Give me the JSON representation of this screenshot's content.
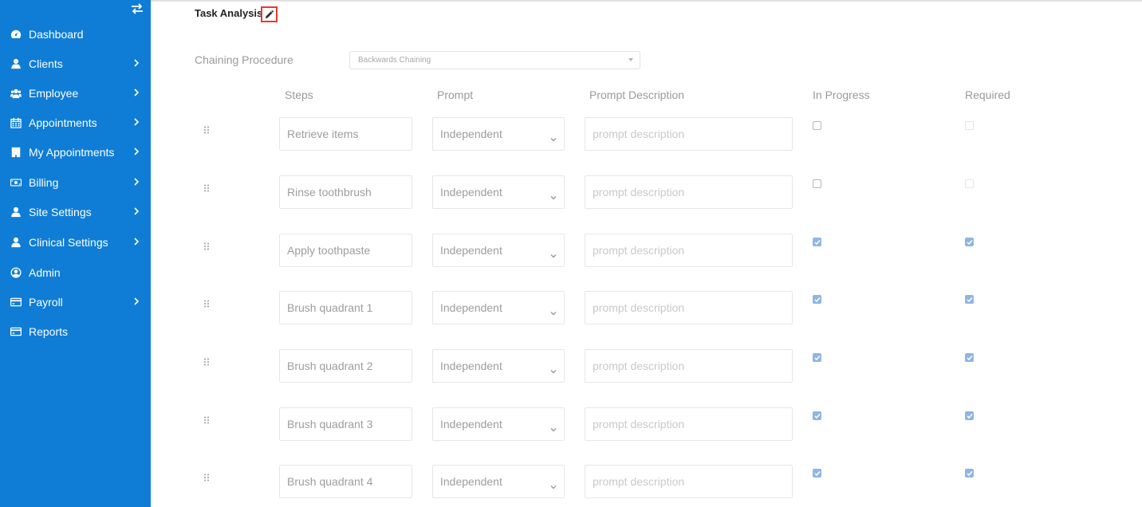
{
  "sidebar": {
    "items": [
      {
        "label": "Dashboard",
        "icon": "dashboard-icon",
        "has_submenu": false
      },
      {
        "label": "Clients",
        "icon": "user-icon",
        "has_submenu": true
      },
      {
        "label": "Employee",
        "icon": "users-icon",
        "has_submenu": true
      },
      {
        "label": "Appointments",
        "icon": "calendar-icon",
        "has_submenu": true
      },
      {
        "label": "My Appointments",
        "icon": "building-icon",
        "has_submenu": true
      },
      {
        "label": "Billing",
        "icon": "money-icon",
        "has_submenu": true
      },
      {
        "label": "Site Settings",
        "icon": "user-icon",
        "has_submenu": true
      },
      {
        "label": "Clinical Settings",
        "icon": "user-icon",
        "has_submenu": true
      },
      {
        "label": "Admin",
        "icon": "user-circle-icon",
        "has_submenu": false
      },
      {
        "label": "Payroll",
        "icon": "credit-card-icon",
        "has_submenu": true
      },
      {
        "label": "Reports",
        "icon": "credit-card-icon",
        "has_submenu": false
      }
    ]
  },
  "header": {
    "title": "Task Analysis"
  },
  "chaining": {
    "label": "Chaining Procedure",
    "value": "Backwards Chaining"
  },
  "columns": {
    "steps": "Steps",
    "prompt": "Prompt",
    "description": "Prompt Description",
    "in_progress": "In Progress",
    "required": "Required"
  },
  "rows": [
    {
      "step": "Retrieve items",
      "prompt": "Independent",
      "description_placeholder": "prompt description",
      "in_progress": false,
      "required": false
    },
    {
      "step": "Rinse toothbrush",
      "prompt": "Independent",
      "description_placeholder": "prompt description",
      "in_progress": false,
      "required": false
    },
    {
      "step": "Apply toothpaste",
      "prompt": "Independent",
      "description_placeholder": "prompt description",
      "in_progress": true,
      "required": true
    },
    {
      "step": "Brush quadrant 1",
      "prompt": "Independent",
      "description_placeholder": "prompt description",
      "in_progress": true,
      "required": true
    },
    {
      "step": "Brush quadrant 2",
      "prompt": "Independent",
      "description_placeholder": "prompt description",
      "in_progress": true,
      "required": true
    },
    {
      "step": "Brush quadrant 3",
      "prompt": "Independent",
      "description_placeholder": "prompt description",
      "in_progress": true,
      "required": true
    },
    {
      "step": "Brush quadrant 4",
      "prompt": "Independent",
      "description_placeholder": "prompt description",
      "in_progress": true,
      "required": true
    }
  ],
  "colors": {
    "sidebar": "#0f7dd6",
    "highlight_border": "#e53b2c",
    "checkbox_checked": "#8fb6e3"
  }
}
